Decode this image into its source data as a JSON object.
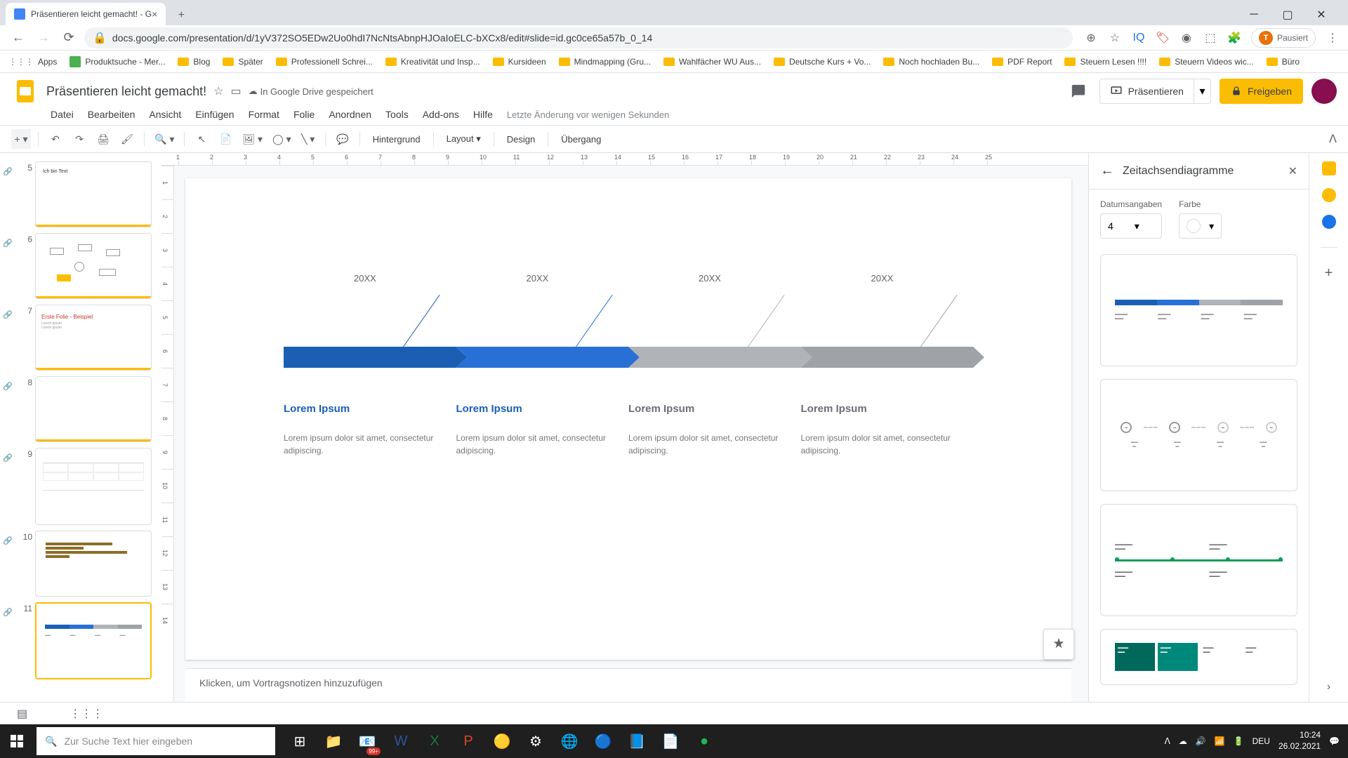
{
  "browser": {
    "tab_title": "Präsentieren leicht gemacht! - G",
    "url": "docs.google.com/presentation/d/1yV372SO5EDw2Uo0hdI7NcNtsAbnpHJOaIoELC-bXCx8/edit#slide=id.gc0ce65a57b_0_14",
    "profile_letter": "T",
    "pause_label": "Pausiert",
    "bookmarks": [
      "Apps",
      "Produktsuche - Mer...",
      "Blog",
      "Später",
      "Professionell Schrei...",
      "Kreativität und Insp...",
      "Kursideen",
      "Mindmapping (Gru...",
      "Wahlfächer WU Aus...",
      "Deutsche Kurs + Vo...",
      "Noch hochladen Bu...",
      "PDF Report",
      "Steuern Lesen !!!!",
      "Steuern Videos wic...",
      "Büro"
    ]
  },
  "app": {
    "doc_title": "Präsentieren leicht gemacht!",
    "drive_status": "In Google Drive gespeichert",
    "present_label": "Präsentieren",
    "share_label": "Freigeben",
    "menus": [
      "Datei",
      "Bearbeiten",
      "Ansicht",
      "Einfügen",
      "Format",
      "Folie",
      "Anordnen",
      "Tools",
      "Add-ons",
      "Hilfe"
    ],
    "last_edit": "Letzte Änderung vor wenigen Sekunden",
    "toolbar": {
      "background": "Hintergrund",
      "layout": "Layout",
      "design": "Design",
      "transition": "Übergang"
    }
  },
  "thumbnails": {
    "visible_numbers": [
      5,
      6,
      7,
      8,
      9,
      10,
      11
    ],
    "slide7_title": "Erste Folie - Beispiel",
    "slide5_text": "Ich bin Text"
  },
  "slide_content": {
    "years": [
      "20XX",
      "20XX",
      "20XX",
      "20XX"
    ],
    "titles": [
      "Lorem Ipsum",
      "Lorem Ipsum",
      "Lorem Ipsum",
      "Lorem Ipsum"
    ],
    "desc": "Lorem ipsum dolor sit amet, consectetur adipiscing.",
    "colors": {
      "blue1": "#1a5fb4",
      "blue2": "#2970d6",
      "gray1": "#b0b3b8",
      "gray2": "#9fa2a7"
    }
  },
  "notes_placeholder": "Klicken, um Vortragsnotizen hinzuzufügen",
  "right_panel": {
    "title": "Zeitachsendiagramme",
    "dates_label": "Datumsangaben",
    "color_label": "Farbe",
    "dates_value": "4"
  },
  "taskbar": {
    "search_placeholder": "Zur Suche Text hier eingeben",
    "mail_count": "99+",
    "lang": "DEU",
    "time": "10:24",
    "date": "26.02.2021"
  }
}
